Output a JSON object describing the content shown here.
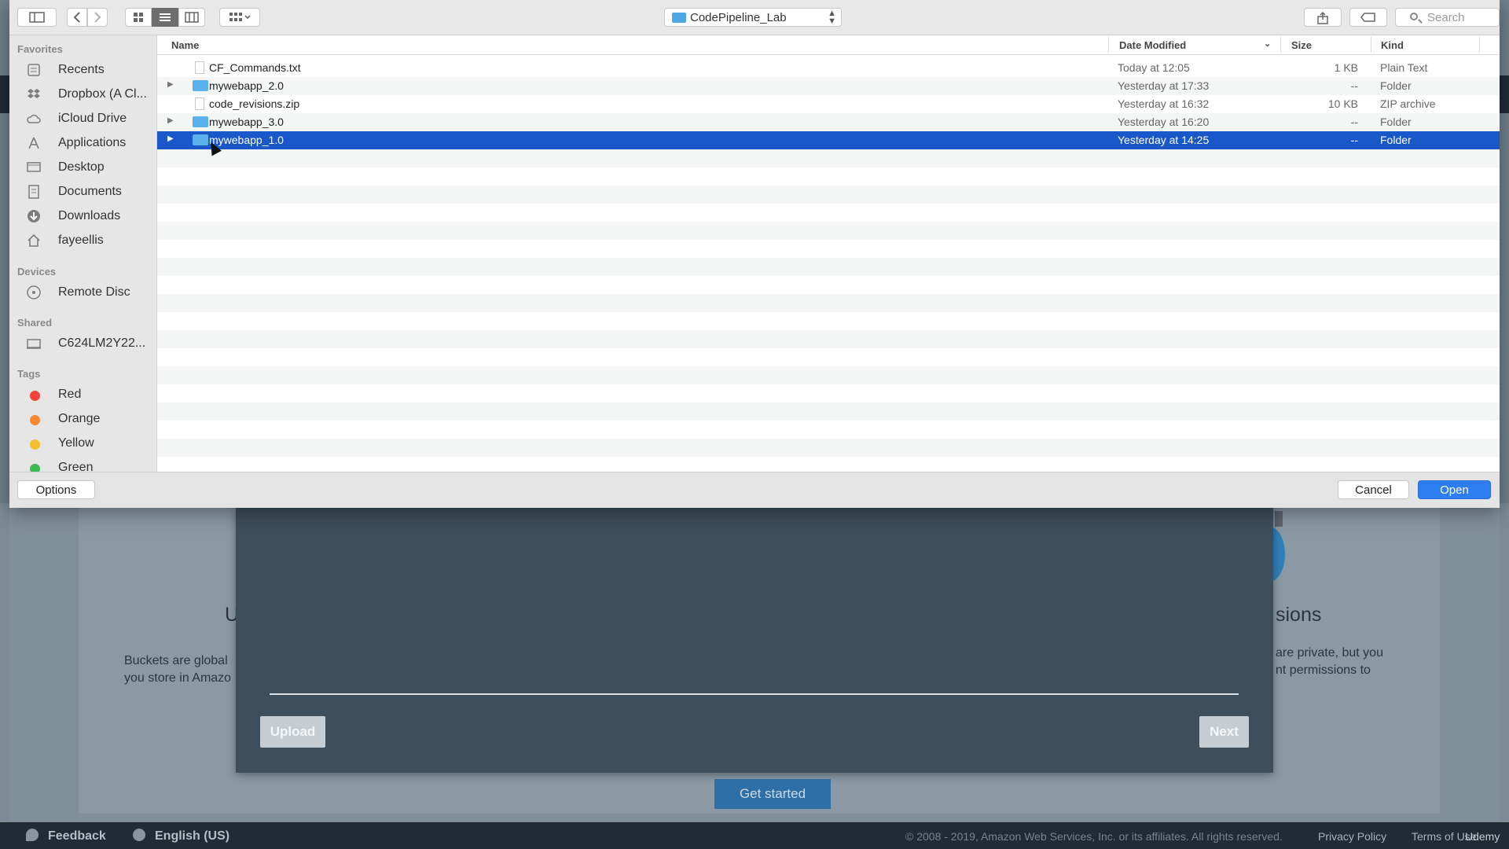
{
  "dialog": {
    "path_folder": "CodePipeline_Lab",
    "search_placeholder": "Search",
    "columns": {
      "name": "Name",
      "date": "Date Modified",
      "size": "Size",
      "kind": "Kind"
    },
    "files": [
      {
        "name": "CF_Commands.txt",
        "date": "Today at 12:05",
        "size": "1 KB",
        "kind": "Plain Text",
        "type": "document",
        "expandable": false,
        "selected": false
      },
      {
        "name": "mywebapp_2.0",
        "date": "Yesterday at 17:33",
        "size": "--",
        "kind": "Folder",
        "type": "folder",
        "expandable": true,
        "selected": false
      },
      {
        "name": "code_revisions.zip",
        "date": "Yesterday at 16:32",
        "size": "10 KB",
        "kind": "ZIP archive",
        "type": "document",
        "expandable": false,
        "selected": false
      },
      {
        "name": "mywebapp_3.0",
        "date": "Yesterday at 16:20",
        "size": "--",
        "kind": "Folder",
        "type": "folder",
        "expandable": true,
        "selected": false
      },
      {
        "name": "mywebapp_1.0",
        "date": "Yesterday at 14:25",
        "size": "--",
        "kind": "Folder",
        "type": "folder",
        "expandable": true,
        "selected": true
      }
    ],
    "options_label": "Options",
    "cancel_label": "Cancel",
    "open_label": "Open",
    "selection_color": "#1a57c8"
  },
  "sidebar": {
    "favorites_title": "Favorites",
    "favorites": [
      {
        "label": "Recents",
        "icon": "recents-icon"
      },
      {
        "label": "Dropbox (A Cl...",
        "icon": "dropbox-icon"
      },
      {
        "label": "iCloud Drive",
        "icon": "cloud-icon"
      },
      {
        "label": "Applications",
        "icon": "applications-icon"
      },
      {
        "label": "Desktop",
        "icon": "desktop-icon"
      },
      {
        "label": "Documents",
        "icon": "documents-icon"
      },
      {
        "label": "Downloads",
        "icon": "downloads-icon"
      },
      {
        "label": "fayeellis",
        "icon": "home-icon"
      }
    ],
    "devices_title": "Devices",
    "devices": [
      {
        "label": "Remote Disc",
        "icon": "disc-icon"
      }
    ],
    "shared_title": "Shared",
    "shared": [
      {
        "label": "C624LM2Y22...",
        "icon": "computer-icon"
      }
    ],
    "tags_title": "Tags",
    "tags": [
      {
        "label": "Red",
        "color": "#f4433c"
      },
      {
        "label": "Orange",
        "color": "#f58a32"
      },
      {
        "label": "Yellow",
        "color": "#f4c030"
      },
      {
        "label": "Green",
        "color": "#3cba54"
      }
    ]
  },
  "background": {
    "left_heading": "U",
    "left_text_1": "Buckets are global",
    "left_text_2": "you store in Amazo",
    "right_heading": "sions",
    "right_text_1": "are private, but you",
    "right_text_2": "nt permissions to",
    "upload_label": "Upload",
    "next_label": "Next",
    "get_started_label": "Get started"
  },
  "footer": {
    "feedback": "Feedback",
    "language": "English (US)",
    "copyright": "© 2008 - 2019, Amazon Web Services, Inc. or its affiliates. All rights reserved.",
    "privacy": "Privacy Policy",
    "terms": "Terms of Use",
    "watermark": "Udemy"
  }
}
